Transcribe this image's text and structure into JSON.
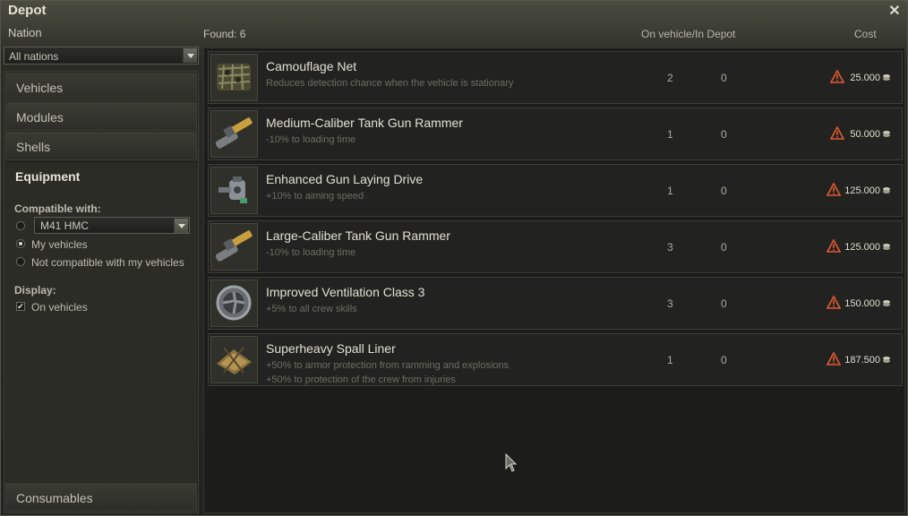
{
  "window": {
    "title": "Depot"
  },
  "filters": {
    "nation_label": "Nation",
    "nation_value": "All nations"
  },
  "sidebar": {
    "items": [
      {
        "label": "Vehicles"
      },
      {
        "label": "Modules"
      },
      {
        "label": "Shells"
      },
      {
        "label": "Equipment"
      }
    ],
    "consumables_label": "Consumables"
  },
  "equipment_filters": {
    "compatible_label": "Compatible with:",
    "vehicle_value": "M41 HMC",
    "radio_my": "My vehicles",
    "radio_not_compatible": "Not compatible with my vehicles",
    "display_label": "Display:",
    "checkbox_on_vehicles": "On vehicles",
    "checkbox_checked": true
  },
  "list_header": {
    "found": "Found: 6",
    "on_vehicle_in_depot": "On vehicle/In Depot",
    "cost": "Cost"
  },
  "items": [
    {
      "name": "Camouflage Net",
      "desc": "Reduces detection chance when the vehicle is stationary",
      "desc2": "",
      "on_vehicle": "2",
      "in_depot": "0",
      "cost": "25.000",
      "icon": "camouflage-net-icon"
    },
    {
      "name": "Medium-Caliber Tank Gun Rammer",
      "desc": "-10% to loading time",
      "desc2": "",
      "on_vehicle": "1",
      "in_depot": "0",
      "cost": "50.000",
      "icon": "gun-rammer-icon"
    },
    {
      "name": "Enhanced Gun Laying Drive",
      "desc": "+10% to aiming speed",
      "desc2": "",
      "on_vehicle": "1",
      "in_depot": "0",
      "cost": "125.000",
      "icon": "gun-laying-drive-icon"
    },
    {
      "name": "Large-Caliber Tank Gun Rammer",
      "desc": "-10% to loading time",
      "desc2": "",
      "on_vehicle": "3",
      "in_depot": "0",
      "cost": "125.000",
      "icon": "gun-rammer-icon"
    },
    {
      "name": "Improved Ventilation Class 3",
      "desc": "+5% to all crew skills",
      "desc2": "",
      "on_vehicle": "3",
      "in_depot": "0",
      "cost": "150.000",
      "icon": "ventilation-icon"
    },
    {
      "name": "Superheavy Spall Liner",
      "desc": "+50% to armor protection from ramming and explosions",
      "desc2": "+50% to protection of the crew from injuries",
      "on_vehicle": "1",
      "in_depot": "0",
      "cost": "187.500",
      "icon": "spall-liner-icon"
    }
  ],
  "colors": {
    "warning": "#e05a32",
    "accent": "#e2e0d3"
  }
}
